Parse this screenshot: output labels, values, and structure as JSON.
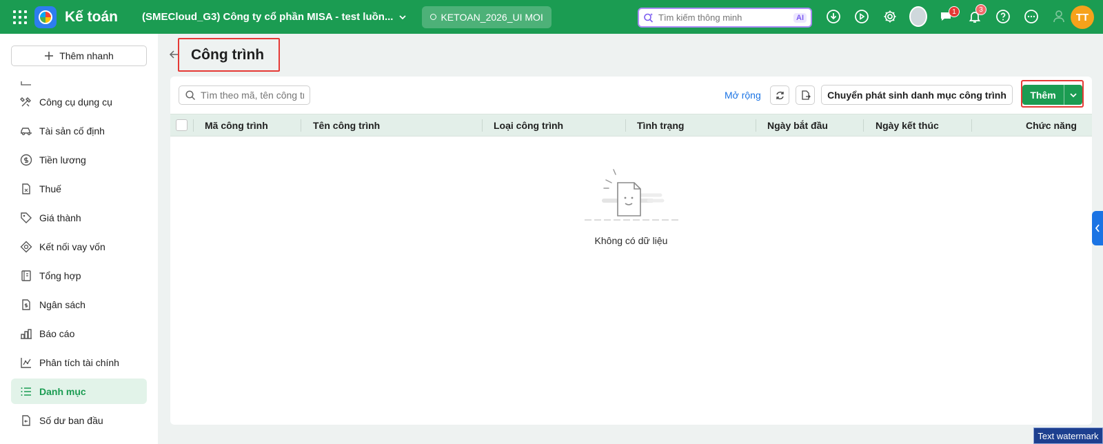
{
  "header": {
    "app_title": "Kế toán",
    "company": "(SMECloud_G3) Công ty cổ phần MISA - test luồn...",
    "database": "KETOAN_2026_UI MOI",
    "ai_search_placeholder": "Tìm kiếm thông minh",
    "ai_badge": "AI",
    "chat_badge": "1",
    "notification_badge": "3",
    "user_initials": "TT"
  },
  "sidebar": {
    "quick_add_label": "Thêm nhanh",
    "items": [
      {
        "label": "Công cụ dụng cụ",
        "icon": "tools-icon"
      },
      {
        "label": "Tài sản cố định",
        "icon": "car-icon"
      },
      {
        "label": "Tiền lương",
        "icon": "dollar-circle-icon"
      },
      {
        "label": "Thuế",
        "icon": "tax-document-icon"
      },
      {
        "label": "Giá thành",
        "icon": "price-tag-icon"
      },
      {
        "label": "Kết nối vay vốn",
        "icon": "loan-link-icon"
      },
      {
        "label": "Tổng hợp",
        "icon": "ledger-icon"
      },
      {
        "label": "Ngân sách",
        "icon": "budget-document-icon"
      },
      {
        "label": "Báo cáo",
        "icon": "bar-chart-icon"
      },
      {
        "label": "Phân tích tài chính",
        "icon": "analytics-icon"
      },
      {
        "label": "Danh mục",
        "icon": "list-icon",
        "active": true
      },
      {
        "label": "Số dư ban đầu",
        "icon": "opening-balance-icon"
      }
    ]
  },
  "page": {
    "title": "Công trình",
    "search_placeholder": "Tìm theo mã, tên công trình",
    "expand_label": "Mở rộng",
    "convert_button": "Chuyển phát sinh danh mục công trình",
    "add_button": "Thêm",
    "columns": [
      "Mã công trình",
      "Tên công trình",
      "Loại công trình",
      "Tình trạng",
      "Ngày bắt đầu",
      "Ngày kết thúc",
      "Chức năng"
    ],
    "empty_text": "Không có dữ liệu"
  },
  "watermark": "Text watermark",
  "colors": {
    "brand": "#1b9c52",
    "highlight": "#e53935",
    "link": "#1b74e4"
  }
}
